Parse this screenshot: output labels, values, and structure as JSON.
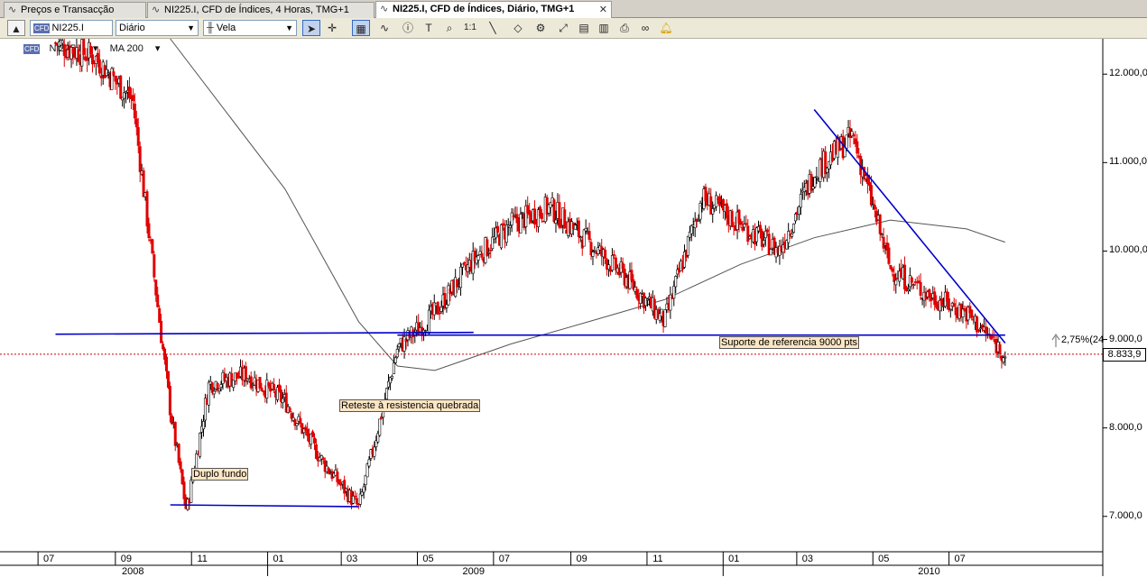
{
  "tabs": [
    {
      "label": "Preços e Transacção",
      "icon": "chart-icon"
    },
    {
      "label": "NI225.I, CFD de Índices, 4 Horas, TMG+1",
      "icon": "chart-icon"
    },
    {
      "label": "NI225.I, CFD de Índices, Diário, TMG+1",
      "icon": "chart-icon",
      "active": true
    }
  ],
  "toolbar": {
    "symbol": "NI225.I",
    "period": "Diário",
    "chart_type": "Vela",
    "zoom_label": "1:1"
  },
  "legend": {
    "symbol": "NI225.I",
    "indicator": "MA 200"
  },
  "annotations": {
    "double_bottom": "Duplo fundo",
    "retest": "Reteste à resistencia quebrada",
    "support": "Suporte de referencia 9000 pts"
  },
  "price_label": "8.833,9",
  "pct_label": "2,75%(24",
  "colors": {
    "up": "#ffffff",
    "down": "#e00000",
    "trendline": "#0000cc",
    "ma": "#555555",
    "last_price_line": "#cc0000"
  },
  "chart_data": {
    "type": "candlestick",
    "symbol": "NI225.I",
    "period": "Diário",
    "ylim": [
      6600,
      12400
    ],
    "y_ticks": [
      "12.000,0",
      "11.000,0",
      "10.000,0",
      "9.000,0",
      "8.000,0",
      "7.000,0"
    ],
    "x_month_labels": [
      "07",
      "09",
      "11",
      "01",
      "03",
      "05",
      "07",
      "09",
      "11",
      "01",
      "03",
      "05",
      "07"
    ],
    "year_labels": [
      "2008",
      "2009",
      "2010"
    ],
    "last_price": 8833.9,
    "support_level": 9050,
    "trendlines": [
      {
        "name": "Suporte de referencia 9000 pts",
        "from": [
          "2009-04",
          9050
        ],
        "to": [
          "2010-08",
          9050
        ]
      },
      {
        "name": "Duplo fundo",
        "from": [
          "2008-10",
          7130
        ],
        "to": [
          "2009-03",
          7110
        ]
      },
      {
        "name": "resistance",
        "from": [
          "2008-07",
          9060
        ],
        "to": [
          "2009-06",
          9080
        ]
      },
      {
        "name": "downtrend",
        "from": [
          "2010-03",
          11600
        ],
        "to": [
          "2010-08",
          8960
        ]
      }
    ],
    "price_path": [
      {
        "date": "2008-07",
        "close": 12350
      },
      {
        "date": "2008-08",
        "close": 12200
      },
      {
        "date": "2008-09",
        "close": 11700
      },
      {
        "date": "2008-10",
        "close": 8200
      },
      {
        "date": "2008-10-28",
        "close": 7050
      },
      {
        "date": "2008-11",
        "close": 8500
      },
      {
        "date": "2008-12",
        "close": 8600
      },
      {
        "date": "2009-01",
        "close": 8300
      },
      {
        "date": "2009-02",
        "close": 7600
      },
      {
        "date": "2009-03",
        "close": 7100
      },
      {
        "date": "2009-04",
        "close": 8900
      },
      {
        "date": "2009-05",
        "close": 9300
      },
      {
        "date": "2009-06",
        "close": 9900
      },
      {
        "date": "2009-07",
        "close": 10300
      },
      {
        "date": "2009-08",
        "close": 10500
      },
      {
        "date": "2009-09",
        "close": 10100
      },
      {
        "date": "2009-10",
        "close": 9700
      },
      {
        "date": "2009-11",
        "close": 9200
      },
      {
        "date": "2009-12",
        "close": 10600
      },
      {
        "date": "2010-01",
        "close": 10300
      },
      {
        "date": "2010-02",
        "close": 10000
      },
      {
        "date": "2010-03",
        "close": 10900
      },
      {
        "date": "2010-04",
        "close": 11300
      },
      {
        "date": "2010-05",
        "close": 9800
      },
      {
        "date": "2010-06",
        "close": 9500
      },
      {
        "date": "2010-07",
        "close": 9300
      },
      {
        "date": "2010-08",
        "close": 8834
      }
    ],
    "ma200": [
      {
        "date": "2008-10",
        "value": 12400
      },
      {
        "date": "2009-01",
        "value": 10700
      },
      {
        "date": "2009-03",
        "value": 9200
      },
      {
        "date": "2009-04",
        "value": 8700
      },
      {
        "date": "2009-05",
        "value": 8650
      },
      {
        "date": "2009-07",
        "value": 8950
      },
      {
        "date": "2009-09",
        "value": 9200
      },
      {
        "date": "2009-11",
        "value": 9450
      },
      {
        "date": "2010-01",
        "value": 9850
      },
      {
        "date": "2010-03",
        "value": 10150
      },
      {
        "date": "2010-05",
        "value": 10350
      },
      {
        "date": "2010-07",
        "value": 10250
      },
      {
        "date": "2010-08",
        "value": 10100
      }
    ]
  }
}
